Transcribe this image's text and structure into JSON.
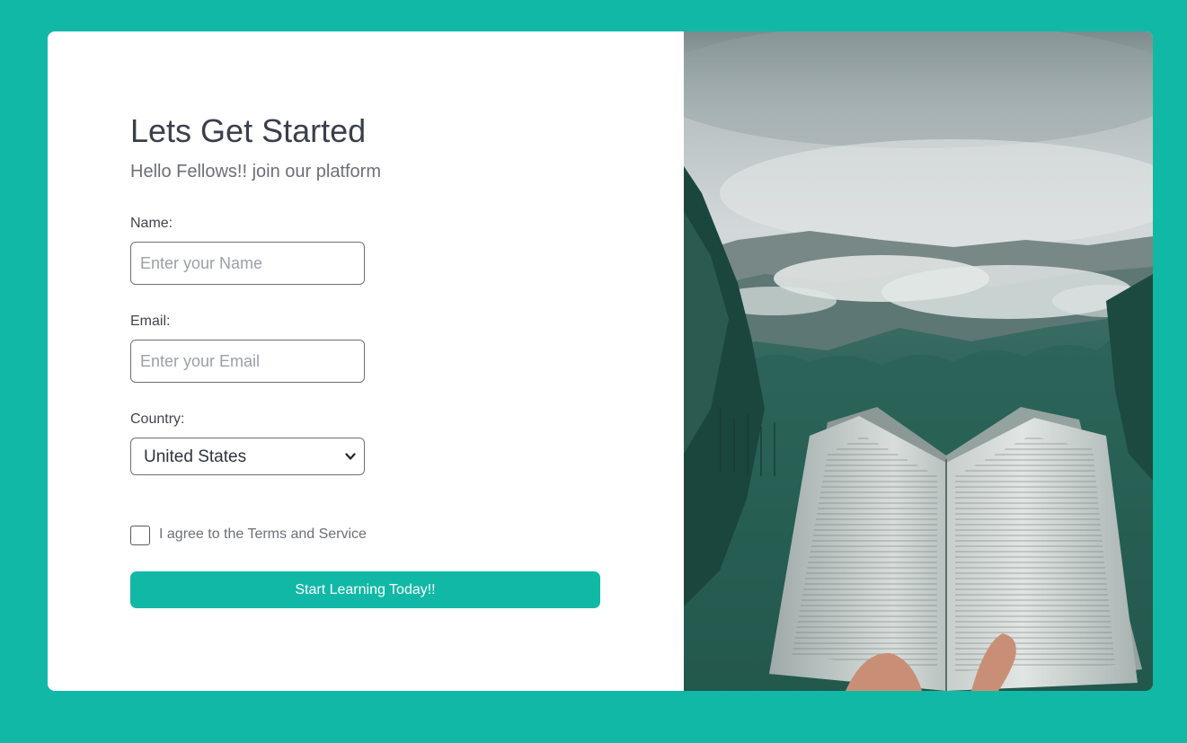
{
  "form": {
    "title": "Lets Get Started",
    "subtitle": "Hello Fellows!! join our platform",
    "name_label": "Name:",
    "name_placeholder": "Enter your Name",
    "name_value": "",
    "email_label": "Email:",
    "email_placeholder": "Enter your Email",
    "email_value": "",
    "country_label": "Country:",
    "country_selected": "United States",
    "terms_checked": false,
    "terms_label": "I agree to the Terms and Service",
    "submit_label": "Start Learning Today!!"
  },
  "image": {
    "alt": "open book held in front of misty forest mountains"
  },
  "colors": {
    "accent": "#12b8a6",
    "card": "#ffffff",
    "heading": "#3a3f4d",
    "muted": "#6b7078"
  },
  "icons": {
    "select": "chevron-down-icon"
  }
}
